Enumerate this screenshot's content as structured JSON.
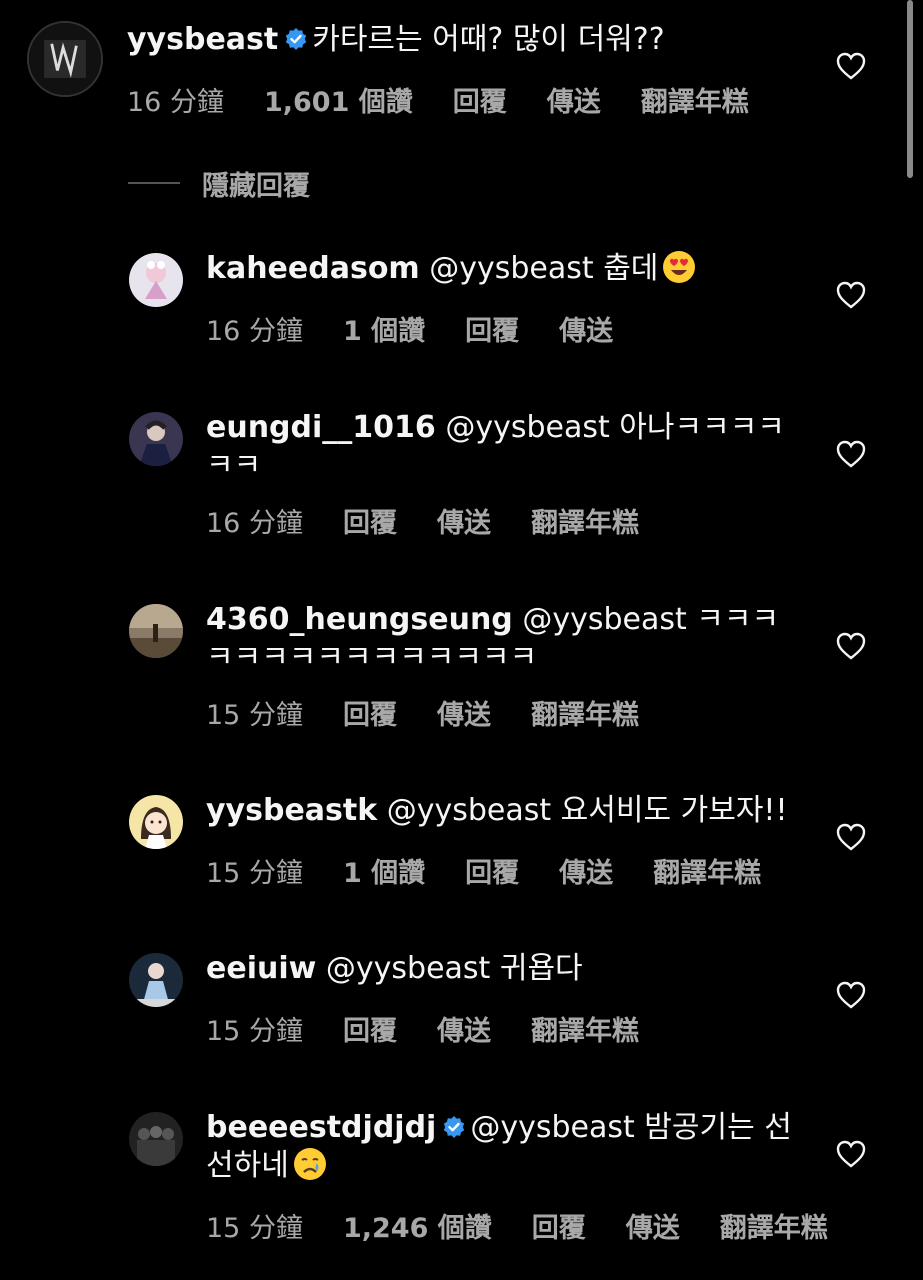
{
  "main_comment": {
    "username": "yysbeast",
    "text": "카타르는 어때? 많이 더워??",
    "time": "16 分鐘",
    "likes": "1,601 個讚",
    "reply": "回覆",
    "send": "傳送",
    "translate": "翻譯年糕"
  },
  "hide_replies": "隱藏回覆",
  "replies": [
    {
      "username": "kaheedasom",
      "text": "@yysbeast 춥데",
      "time": "16 分鐘",
      "likes": "1 個讚",
      "reply": "回覆",
      "send": "傳送"
    },
    {
      "username": "eungdi__1016",
      "text": "@yysbeast 아나ㅋㅋㅋㅋㅋㅋ",
      "time": "16 分鐘",
      "reply": "回覆",
      "send": "傳送",
      "translate": "翻譯年糕"
    },
    {
      "username": "4360_heungseung",
      "text": "@yysbeast ㅋㅋㅋㅋㅋㅋㅋㅋㅋㅋㅋㅋㅋㅋㅋ",
      "time": "15 分鐘",
      "reply": "回覆",
      "send": "傳送",
      "translate": "翻譯年糕"
    },
    {
      "username": "yysbeastk",
      "text": "@yysbeast 요서비도 가보자!!",
      "time": "15 分鐘",
      "likes": "1 個讚",
      "reply": "回覆",
      "send": "傳送",
      "translate": "翻譯年糕"
    },
    {
      "username": "eeiuiw",
      "text": "@yysbeast 귀욥다",
      "time": "15 分鐘",
      "reply": "回覆",
      "send": "傳送",
      "translate": "翻譯年糕"
    },
    {
      "username": "beeeestdjdjdj",
      "text": "@yysbeast 밤공기는 선선하네",
      "time": "15 分鐘",
      "likes": "1,246 個讚",
      "reply": "回覆",
      "send": "傳送",
      "translate": "翻譯年糕"
    }
  ]
}
